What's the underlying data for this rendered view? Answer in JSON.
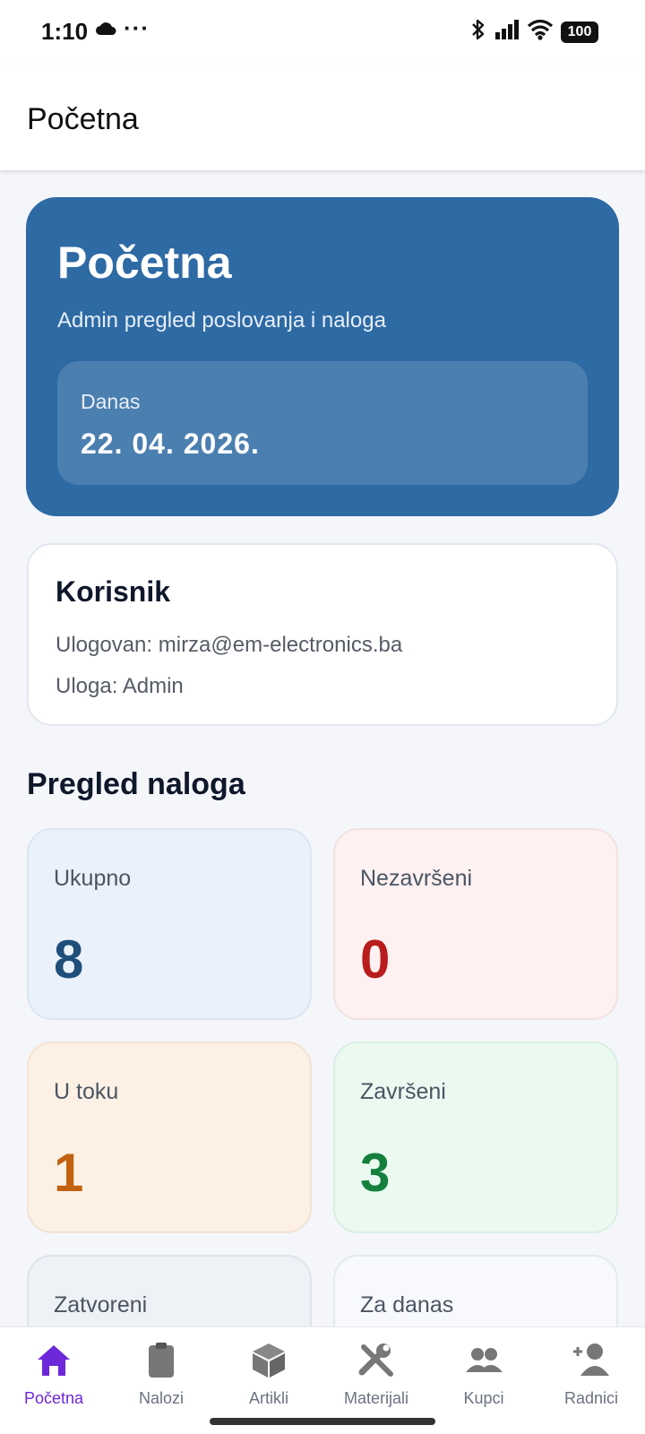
{
  "status_bar": {
    "time": "1:10",
    "dots": "···",
    "battery": "100"
  },
  "app_bar": {
    "title": "Početna"
  },
  "hero": {
    "title": "Početna",
    "subtitle": "Admin pregled poslovanja i naloga",
    "date_label": "Danas",
    "date_value": "22. 04. 2026.",
    "color": "#2e6aa4"
  },
  "user_card": {
    "title": "Korisnik",
    "logged_in": "Ulogovan: mirza@em-electronics.ba",
    "role": "Uloga: Admin"
  },
  "overview": {
    "title": "Pregled naloga",
    "stats": [
      {
        "label": "Ukupno",
        "value": "8",
        "color": "#1f4e7a"
      },
      {
        "label": "Nezavršeni",
        "value": "0",
        "color": "#b91c1c"
      },
      {
        "label": "U toku",
        "value": "1",
        "color": "#c2620f"
      },
      {
        "label": "Završeni",
        "value": "3",
        "color": "#15803d"
      },
      {
        "label": "Zatvoreni",
        "value": ""
      },
      {
        "label": "Za danas",
        "value": ""
      }
    ]
  },
  "bottom_nav": {
    "active_color": "#6d28d9",
    "items": [
      {
        "label": "Početna",
        "icon": "home-icon"
      },
      {
        "label": "Nalozi",
        "icon": "clipboard-icon"
      },
      {
        "label": "Artikli",
        "icon": "box-icon"
      },
      {
        "label": "Materijali",
        "icon": "tools-icon"
      },
      {
        "label": "Kupci",
        "icon": "users-icon"
      },
      {
        "label": "Radnici",
        "icon": "add-user-icon"
      }
    ]
  }
}
